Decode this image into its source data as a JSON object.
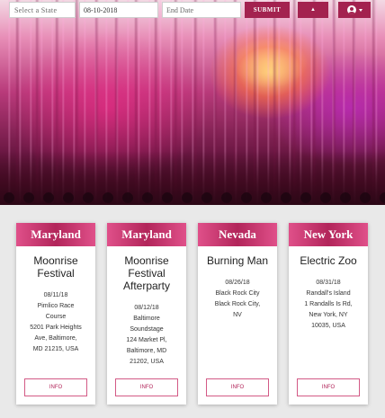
{
  "search": {
    "state_placeholder": "Select a State",
    "start_date": "08-10-2018",
    "end_placeholder": "End Date",
    "submit_label": "SUBMIT"
  },
  "icons": {
    "menu_caret": "caret-up-icon",
    "user": "user-circle-icon"
  },
  "colors": {
    "accent": "#a3224f",
    "card_header": "#c63a6f"
  },
  "events": [
    {
      "state": "Maryland",
      "title_lines": [
        "Moonrise",
        "Festival"
      ],
      "date": "08/11/18",
      "location_lines": [
        "Pimlico Race",
        "Course",
        "5201 Park Heights",
        "Ave, Baltimore,",
        "MD 21215, USA"
      ],
      "button": "INFO"
    },
    {
      "state": "Maryland",
      "title_lines": [
        "Moonrise",
        "Festival",
        "Afterparty"
      ],
      "date": "08/12/18",
      "location_lines": [
        "Baltimore",
        "Soundstage",
        "124 Market Pl,",
        "Baltimore, MD",
        "21202, USA"
      ],
      "button": "INFO"
    },
    {
      "state": "Nevada",
      "title_lines": [
        "Burning Man"
      ],
      "date": "08/26/18",
      "location_lines": [
        "Black Rock City",
        "Black Rock City,",
        "NV"
      ],
      "button": "INFO"
    },
    {
      "state": "New York",
      "title_lines": [
        "Electric Zoo"
      ],
      "date": "08/31/18",
      "location_lines": [
        "Randall's Island",
        "1 Randalls Is Rd,",
        "New York, NY",
        "10035, USA"
      ],
      "button": "INFO"
    }
  ]
}
